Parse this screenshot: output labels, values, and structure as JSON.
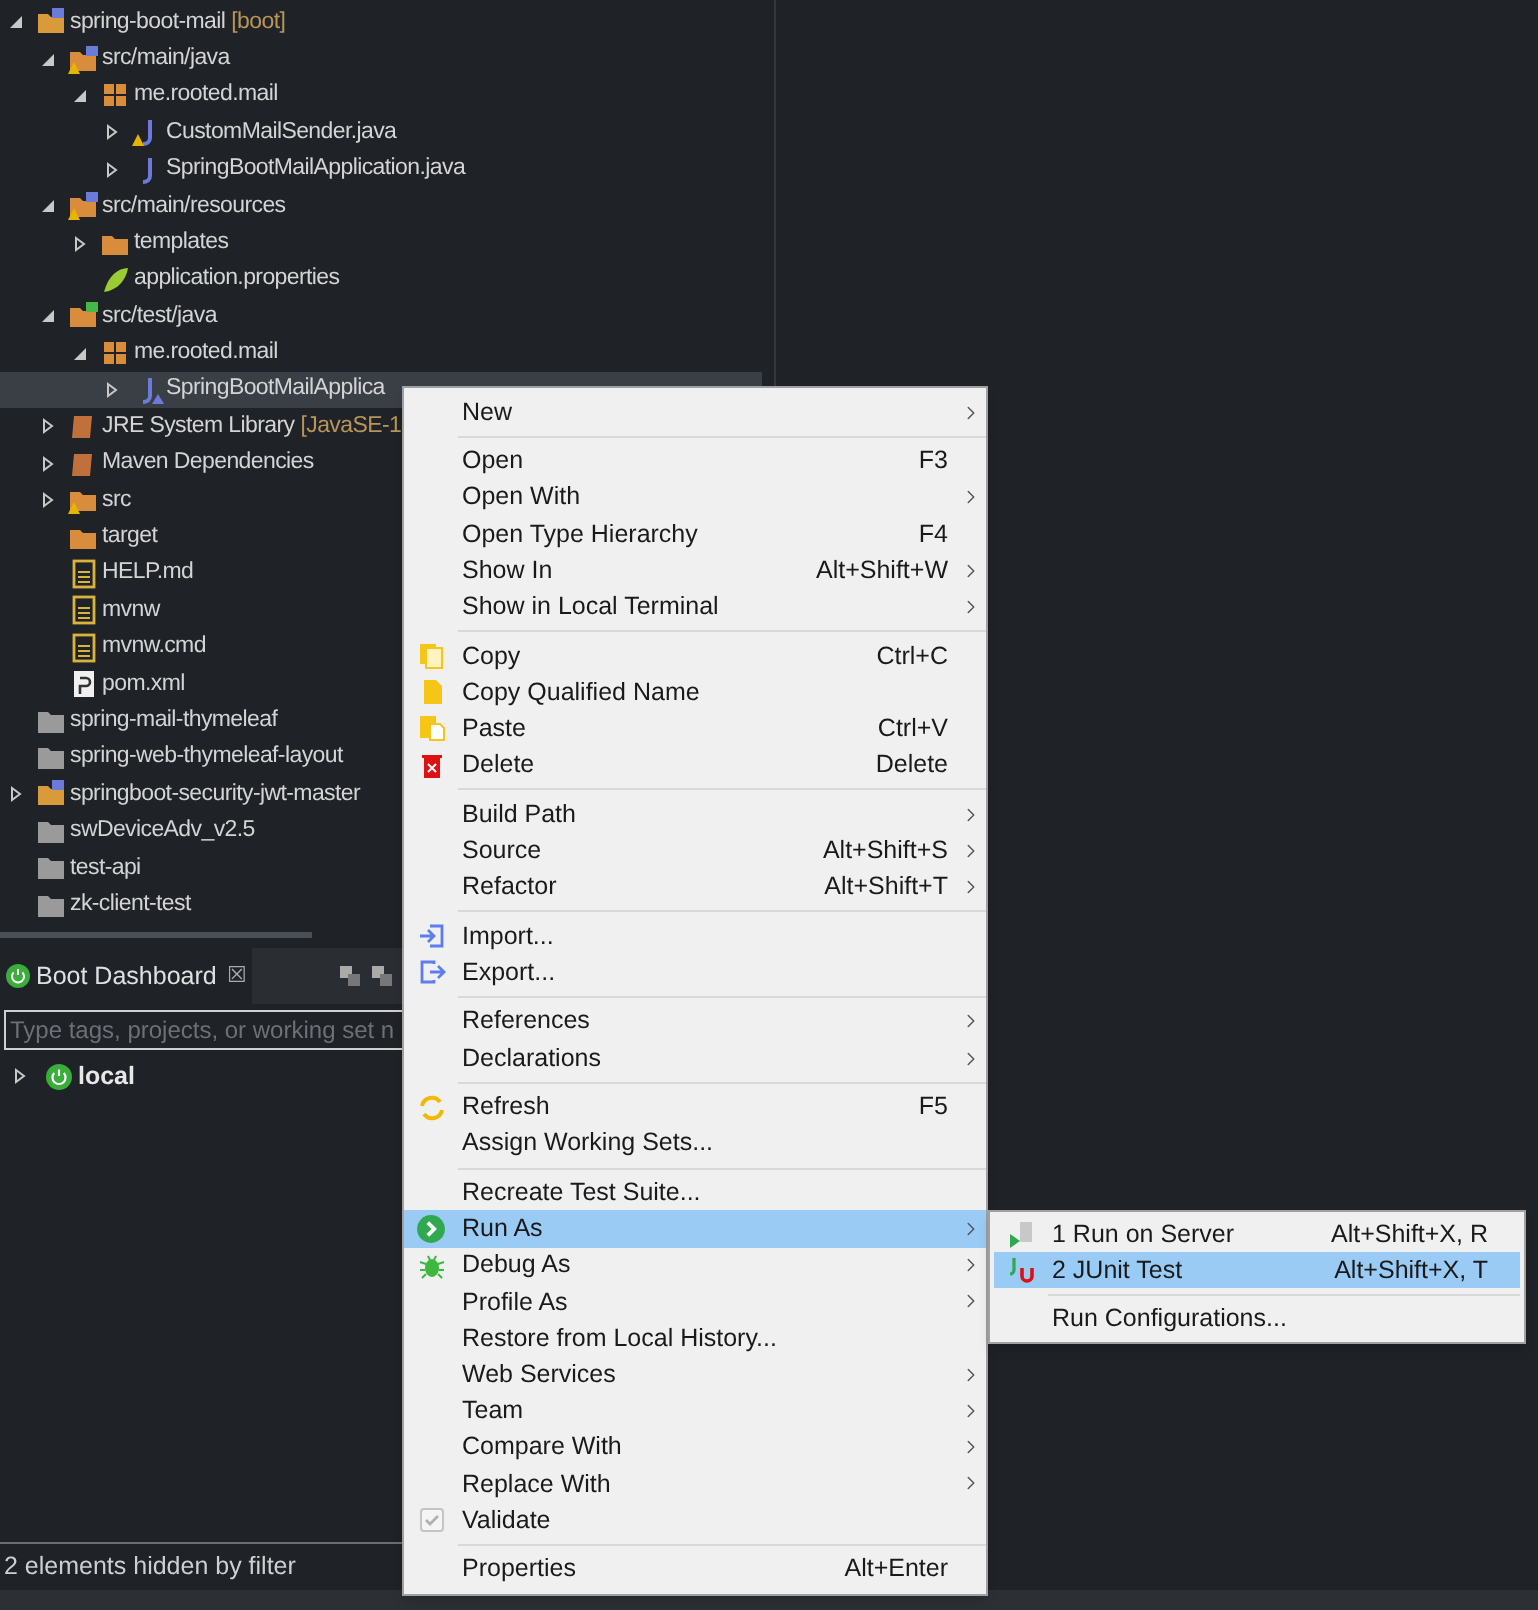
{
  "explorer": {
    "tree": [
      {
        "label": "spring-boot-mail",
        "decoration": "[boot]",
        "kind": "project",
        "expanded": true,
        "selected": false,
        "children": [
          {
            "label": "src/main/java",
            "kind": "source-folder",
            "expanded": true,
            "selected": false,
            "children": [
              {
                "label": "me.rooted.mail",
                "kind": "package",
                "expanded": true,
                "selected": false,
                "children": [
                  {
                    "label": "CustomMailSender.java",
                    "kind": "java-warning",
                    "expanded": false,
                    "selected": false
                  },
                  {
                    "label": "SpringBootMailApplication.java",
                    "kind": "java",
                    "expanded": false,
                    "selected": false
                  }
                ]
              }
            ]
          },
          {
            "label": "src/main/resources",
            "kind": "source-folder",
            "expanded": true,
            "selected": false,
            "children": [
              {
                "label": "templates",
                "kind": "folder",
                "expanded": false,
                "selected": false
              },
              {
                "label": "application.properties",
                "kind": "properties",
                "selected": false
              }
            ]
          },
          {
            "label": "src/test/java",
            "kind": "test-folder",
            "expanded": true,
            "selected": false,
            "children": [
              {
                "label": "me.rooted.mail",
                "kind": "package",
                "expanded": true,
                "selected": false,
                "children": [
                  {
                    "label": "SpringBootMailApplica",
                    "kind": "java-test",
                    "expanded": false,
                    "selected": true
                  }
                ]
              }
            ]
          },
          {
            "label": "JRE System Library",
            "decoration": "[JavaSE-1",
            "kind": "library",
            "expanded": false,
            "selected": false
          },
          {
            "label": "Maven Dependencies",
            "kind": "library",
            "expanded": false,
            "selected": false
          },
          {
            "label": "src",
            "kind": "folder-warning",
            "expanded": false,
            "selected": false
          },
          {
            "label": "target",
            "kind": "folder",
            "selected": false
          },
          {
            "label": "HELP.md",
            "kind": "file",
            "selected": false
          },
          {
            "label": "mvnw",
            "kind": "file",
            "selected": false
          },
          {
            "label": "mvnw.cmd",
            "kind": "file",
            "selected": false
          },
          {
            "label": "pom.xml",
            "kind": "pom",
            "selected": false
          }
        ]
      },
      {
        "label": "spring-mail-thymeleaf",
        "kind": "closed-project",
        "selected": false
      },
      {
        "label": "spring-web-thymeleaf-layout",
        "kind": "closed-project",
        "selected": false
      },
      {
        "label": "springboot-security-jwt-master",
        "kind": "project",
        "expanded": false,
        "selected": false
      },
      {
        "label": "swDeviceAdv_v2.5",
        "kind": "closed-project",
        "selected": false
      },
      {
        "label": "test-api",
        "kind": "closed-project",
        "selected": false
      },
      {
        "label": "zk-client-test",
        "kind": "closed-project",
        "selected": false
      }
    ]
  },
  "boot_dashboard": {
    "tab": "Boot Dashboard",
    "close": "☒",
    "filter": {
      "placeholder": "Type tags, projects, or working set n"
    },
    "items": [
      {
        "label": "local",
        "expanded": false
      }
    ],
    "status": "2 elements hidden by filter"
  },
  "context_menu": {
    "items": [
      {
        "kind": "plain",
        "label": "New",
        "submenu": true,
        "selected": false
      },
      {
        "kind": "separator"
      },
      {
        "kind": "plain",
        "label": "Open",
        "shortcut": "F3",
        "submenu": false,
        "selected": false
      },
      {
        "kind": "plain",
        "label": "Open With",
        "submenu": true,
        "selected": false
      },
      {
        "kind": "plain",
        "label": "Open Type Hierarchy",
        "shortcut": "F4",
        "submenu": false,
        "selected": false
      },
      {
        "kind": "plain",
        "label": "Show In",
        "shortcut": "Alt+Shift+W",
        "submenu": true,
        "selected": false
      },
      {
        "kind": "plain",
        "label": "Show in Local Terminal",
        "submenu": true,
        "selected": false
      },
      {
        "kind": "separator"
      },
      {
        "kind": "copy",
        "label": "Copy",
        "shortcut": "Ctrl+C",
        "submenu": false,
        "selected": false
      },
      {
        "kind": "copy-name",
        "label": "Copy Qualified Name",
        "submenu": false,
        "selected": false
      },
      {
        "kind": "paste",
        "label": "Paste",
        "shortcut": "Ctrl+V",
        "submenu": false,
        "selected": false
      },
      {
        "kind": "delete",
        "label": "Delete",
        "shortcut": "Delete",
        "submenu": false,
        "selected": false
      },
      {
        "kind": "separator"
      },
      {
        "kind": "plain",
        "label": "Build Path",
        "submenu": true,
        "selected": false
      },
      {
        "kind": "plain",
        "label": "Source",
        "shortcut": "Alt+Shift+S",
        "submenu": true,
        "selected": false
      },
      {
        "kind": "plain",
        "label": "Refactor",
        "shortcut": "Alt+Shift+T",
        "submenu": true,
        "selected": false
      },
      {
        "kind": "separator"
      },
      {
        "kind": "import",
        "label": "Import...",
        "submenu": false,
        "selected": false
      },
      {
        "kind": "export",
        "label": "Export...",
        "submenu": false,
        "selected": false
      },
      {
        "kind": "separator"
      },
      {
        "kind": "plain",
        "label": "References",
        "submenu": true,
        "selected": false
      },
      {
        "kind": "plain",
        "label": "Declarations",
        "submenu": true,
        "selected": false
      },
      {
        "kind": "separator"
      },
      {
        "kind": "refresh",
        "label": "Refresh",
        "shortcut": "F5",
        "submenu": false,
        "selected": false
      },
      {
        "kind": "plain",
        "label": "Assign Working Sets...",
        "submenu": false,
        "selected": false
      },
      {
        "kind": "separator"
      },
      {
        "kind": "plain",
        "label": "Recreate Test Suite...",
        "submenu": false,
        "selected": false
      },
      {
        "kind": "run",
        "label": "Run As",
        "submenu": true,
        "selected": true
      },
      {
        "kind": "debug",
        "label": "Debug As",
        "submenu": true,
        "selected": false
      },
      {
        "kind": "plain",
        "label": "Profile As",
        "submenu": true,
        "selected": false
      },
      {
        "kind": "plain",
        "label": "Restore from Local History...",
        "submenu": false,
        "selected": false
      },
      {
        "kind": "plain",
        "label": "Web Services",
        "submenu": true,
        "selected": false
      },
      {
        "kind": "plain",
        "label": "Team",
        "submenu": true,
        "selected": false
      },
      {
        "kind": "plain",
        "label": "Compare With",
        "submenu": true,
        "selected": false
      },
      {
        "kind": "plain",
        "label": "Replace With",
        "submenu": true,
        "selected": false
      },
      {
        "kind": "validate",
        "label": "Validate",
        "submenu": false,
        "selected": false
      },
      {
        "kind": "separator"
      },
      {
        "kind": "plain",
        "label": "Properties",
        "shortcut": "Alt+Enter",
        "submenu": false,
        "selected": false
      }
    ]
  },
  "submenu": {
    "items": [
      {
        "kind": "server",
        "label": "1 Run on Server",
        "shortcut": "Alt+Shift+X, R",
        "submenu": false,
        "selected": false
      },
      {
        "kind": "junit",
        "label": "2 JUnit Test",
        "shortcut": "Alt+Shift+X, T",
        "submenu": false,
        "selected": true
      },
      {
        "kind": "separator"
      },
      {
        "kind": "plain",
        "label": "Run Configurations...",
        "submenu": false,
        "selected": false
      }
    ]
  }
}
